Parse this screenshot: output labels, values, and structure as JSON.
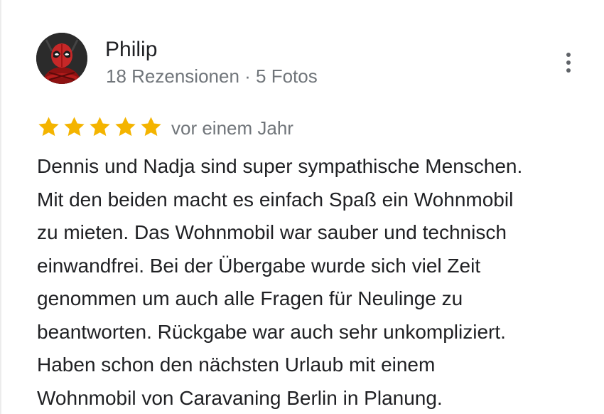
{
  "review": {
    "author": {
      "name": "Philip",
      "meta": "18 Rezensionen · 5 Fotos",
      "avatar_icon": "deadpool-avatar-icon"
    },
    "more_icon": "more-vert-icon",
    "rating": {
      "stars": 5,
      "max": 5,
      "star_color": "#f4b400"
    },
    "date": "vor einem Jahr",
    "text_lines": [
      "Dennis und Nadja sind super sympathische Menschen.",
      "Mit den beiden macht es einfach Spaß ein Wohnmobil",
      "zu mieten. Das Wohnmobil war sauber und technisch",
      "einwandfrei. Bei der Übergabe wurde sich viel Zeit",
      "genommen um auch alle Fragen für Neulinge zu",
      "beantworten. Rückgabe war auch sehr unkompliziert.",
      "Haben schon den nächsten Urlaub mit einem",
      "Wohnmobil von Caravaning Berlin in Planung."
    ]
  }
}
